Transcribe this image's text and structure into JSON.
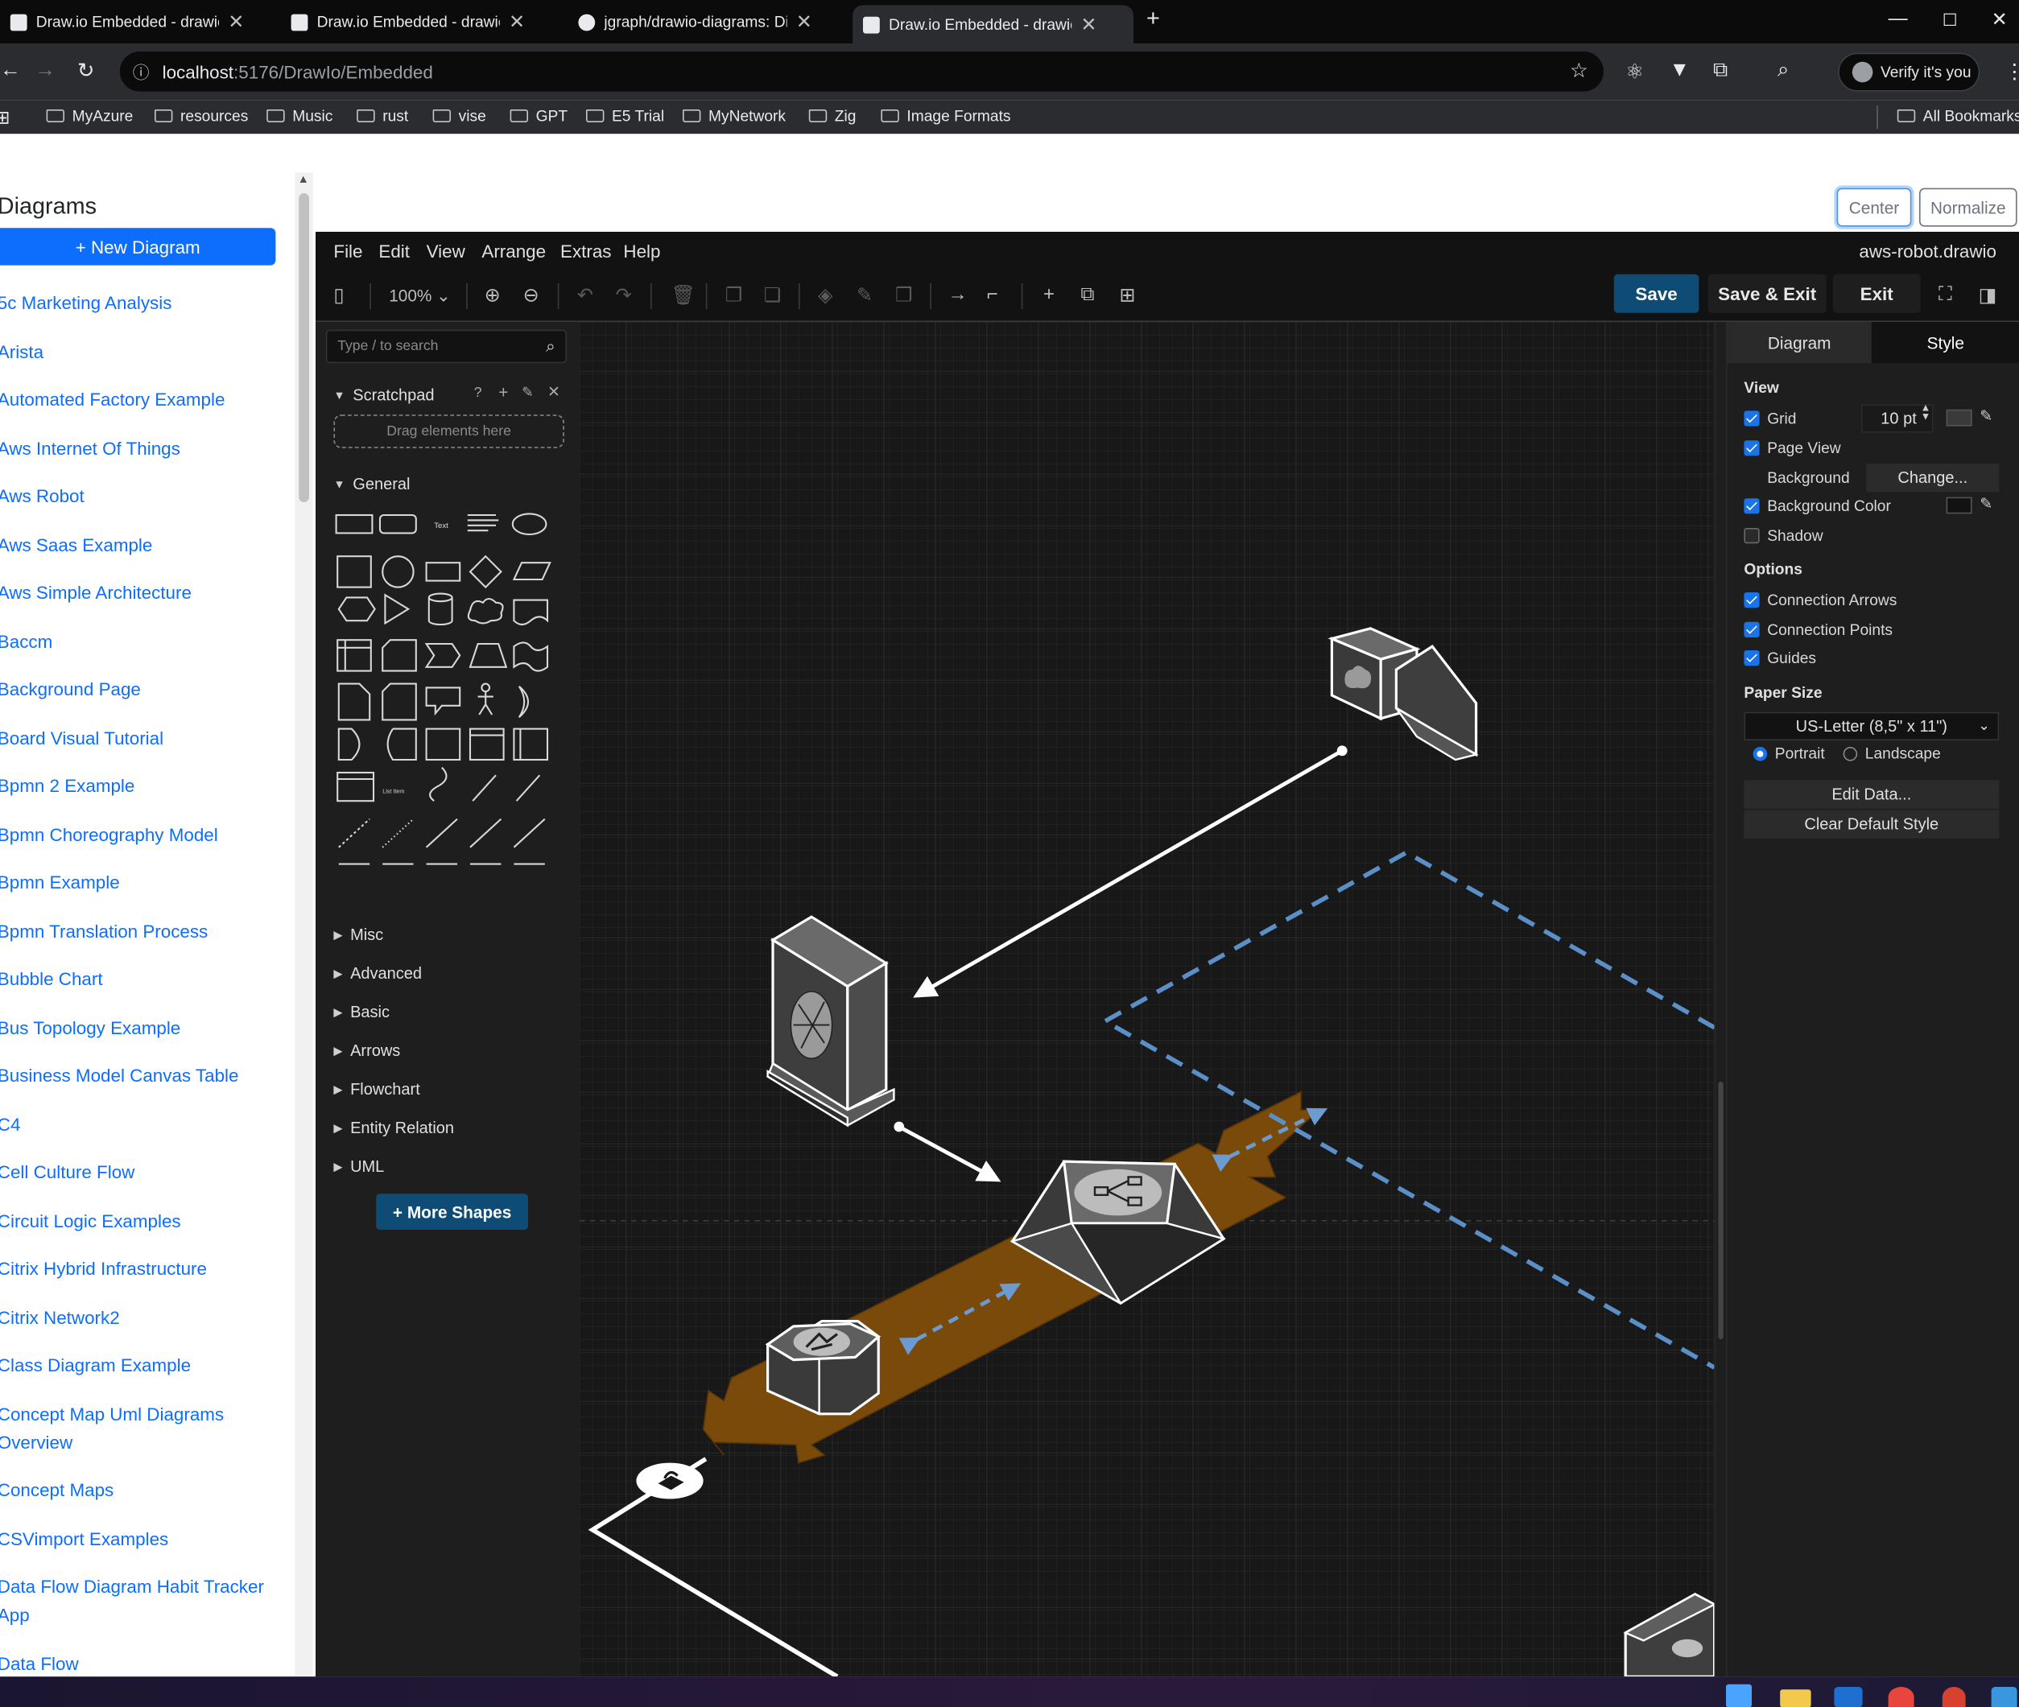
{
  "browser": {
    "tabs": [
      {
        "title": "Draw.io Embedded - drawiomv",
        "active": false
      },
      {
        "title": "Draw.io Embedded - drawiomv",
        "active": false
      },
      {
        "title": "jgraph/drawio-diagrams: Diagra",
        "active": false
      },
      {
        "title": "Draw.io Embedded - drawiomv",
        "active": true
      }
    ],
    "url_host": "localhost",
    "url_path": ":5176/DrawIo/Embedded",
    "profile_label": "Verify it's you",
    "bookmarks": [
      "MyAzure",
      "resources",
      "Music",
      "rust",
      "vise",
      "GPT",
      "E5 Trial",
      "MyNetwork",
      "Zig",
      "Image Formats"
    ],
    "all_bookmarks": "All Bookmarks"
  },
  "left_panel": {
    "title": "Diagrams",
    "new_diagram": "+ New Diagram",
    "diagrams": [
      "5c Marketing Analysis",
      "Arista",
      "Automated Factory Example",
      "Aws Internet Of Things",
      "Aws Robot",
      "Aws Saas Example",
      "Aws Simple Architecture",
      "Baccm",
      "Background Page",
      "Board Visual Tutorial",
      "Bpmn 2 Example",
      "Bpmn Choreography Model",
      "Bpmn Example",
      "Bpmn Translation Process",
      "Bubble Chart",
      "Bus Topology Example",
      "Business Model Canvas Table",
      "C4",
      "Cell Culture Flow",
      "Circuit Logic Examples",
      "Citrix Hybrid Infrastructure",
      "Citrix Network2",
      "Class Diagram Example",
      "Concept Map Uml Diagrams Overview",
      "Concept Maps",
      "CSVimport Examples",
      "Data Flow Diagram Habit Tracker App",
      "Data Flow"
    ]
  },
  "top_buttons": {
    "center": "Center",
    "normalize": "Normalize"
  },
  "editor": {
    "menus": [
      "File",
      "Edit",
      "View",
      "Arrange",
      "Extras",
      "Help"
    ],
    "filename": "aws-robot.drawio",
    "zoom": "100%",
    "save": "Save",
    "save_exit": "Save & Exit",
    "exit": "Exit",
    "sidebar": {
      "search_placeholder": "Type / to search",
      "scratchpad": "Scratchpad",
      "drop_hint": "Drag elements here",
      "general": "General",
      "sections": [
        "Misc",
        "Advanced",
        "Basic",
        "Arrows",
        "Flowchart",
        "Entity Relation",
        "UML"
      ],
      "more_shapes": "+ More Shapes"
    },
    "format": {
      "tabs": [
        "Diagram",
        "Style"
      ],
      "view_header": "View",
      "grid": "Grid",
      "grid_size": "10 pt",
      "page_view": "Page View",
      "background": "Background",
      "change": "Change...",
      "background_color": "Background Color",
      "shadow": "Shadow",
      "options_header": "Options",
      "connection_arrows": "Connection Arrows",
      "connection_points": "Connection Points",
      "guides": "Guides",
      "paper_size_header": "Paper Size",
      "paper_size": "US-Letter (8,5\" x 11\")",
      "portrait": "Portrait",
      "landscape": "Landscape",
      "edit_data": "Edit Data...",
      "clear_default_style": "Clear Default Style"
    }
  },
  "colors": {
    "accent": "#0d6efd",
    "drawio_blue": "#0f4c75",
    "band": "#7a4a0a",
    "dashed": "#5b8fc7"
  }
}
